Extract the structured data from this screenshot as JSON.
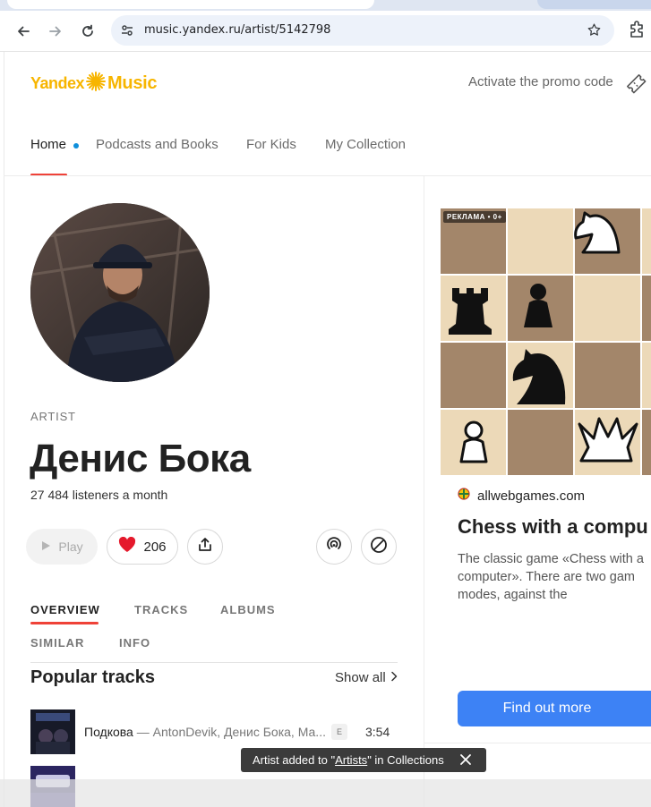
{
  "browser": {
    "url": "music.yandex.ru/artist/5142798"
  },
  "site": {
    "logo_word1": "Yandex",
    "logo_word2": "Music",
    "promo_label": "Activate the promo code",
    "brand_color": "#f7b500",
    "accent_color": "#ef4238"
  },
  "nav": {
    "items": [
      {
        "label": "Home",
        "active": true
      },
      {
        "label": "Podcasts and Books"
      },
      {
        "label": "For Kids"
      },
      {
        "label": "My Collection"
      }
    ]
  },
  "artist": {
    "kicker": "ARTIST",
    "name": "Денис Бока",
    "listeners": "27 484  listeners a month",
    "play_label": "Play",
    "likes": "206"
  },
  "tabs": [
    {
      "label": "OVERVIEW",
      "active": true
    },
    {
      "label": "TRACKS"
    },
    {
      "label": "ALBUMS"
    },
    {
      "label": "SIMILAR"
    },
    {
      "label": "INFO"
    }
  ],
  "popular": {
    "title": "Popular tracks",
    "show_all": "Show all",
    "tracks": [
      {
        "name": "Подкова",
        "separator": " — ",
        "artists": "AntonDevik, Денис Бока, Ма...",
        "explicit": "E",
        "duration": "3:54"
      }
    ]
  },
  "ad": {
    "label": "РЕКЛАМА • 0+",
    "domain": "allwebgames.com",
    "title": "Chess with a compu",
    "description": "The classic game «Chess with a\ncomputer». There are two gam\nmodes, against the",
    "cta": "Find out more",
    "cta_color": "#3d82f5"
  },
  "toast": {
    "prefix": "Artist added to \"",
    "link": "Artists",
    "suffix": "\" in Collections"
  }
}
